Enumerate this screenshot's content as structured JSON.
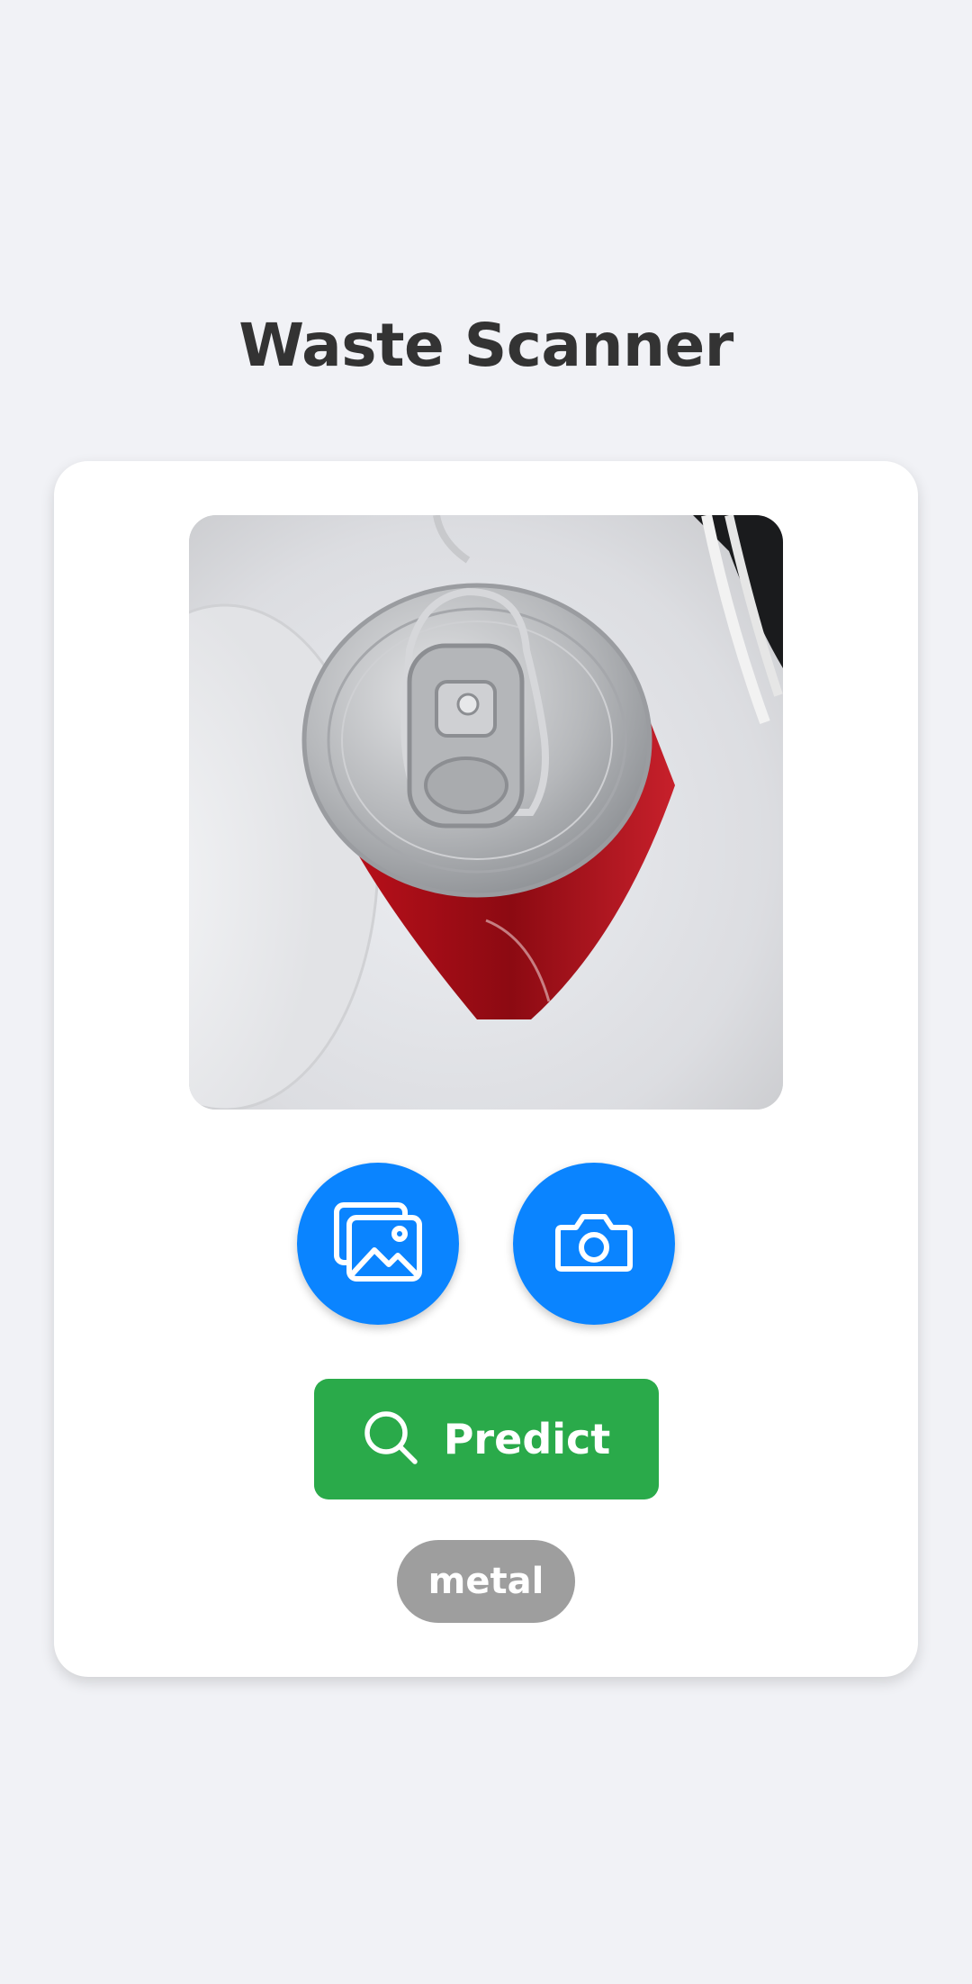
{
  "header": {
    "title": "Waste Scanner"
  },
  "card": {
    "image_alt": "aluminum soda can top",
    "gallery_button": {
      "icon": "gallery-icon"
    },
    "camera_button": {
      "icon": "camera-icon"
    },
    "predict_button": {
      "label": "Predict",
      "icon": "search-icon"
    },
    "result": {
      "label": "metal"
    }
  },
  "colors": {
    "background": "#f1f2f6",
    "card": "#ffffff",
    "icon_button": "#0a84ff",
    "predict_button": "#2aaa4a",
    "result_badge": "#9e9e9e",
    "title": "#333333"
  }
}
